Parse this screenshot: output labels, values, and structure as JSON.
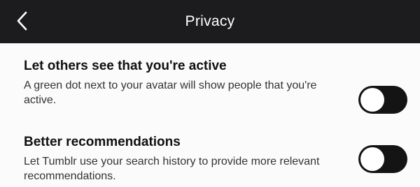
{
  "header": {
    "title": "Privacy",
    "back_icon": "chevron-left-icon"
  },
  "settings": [
    {
      "title": "Let others see that you're active",
      "description": "A green dot next to your avatar will show people that you're active.",
      "enabled": false
    },
    {
      "title": "Better recommendations",
      "description": "Let Tumblr use your search history to provide more relevant recommendations.",
      "enabled": false
    }
  ],
  "colors": {
    "header_bg": "#1c1c1e",
    "toggle_off": "#141414",
    "knob": "#ffffff"
  }
}
